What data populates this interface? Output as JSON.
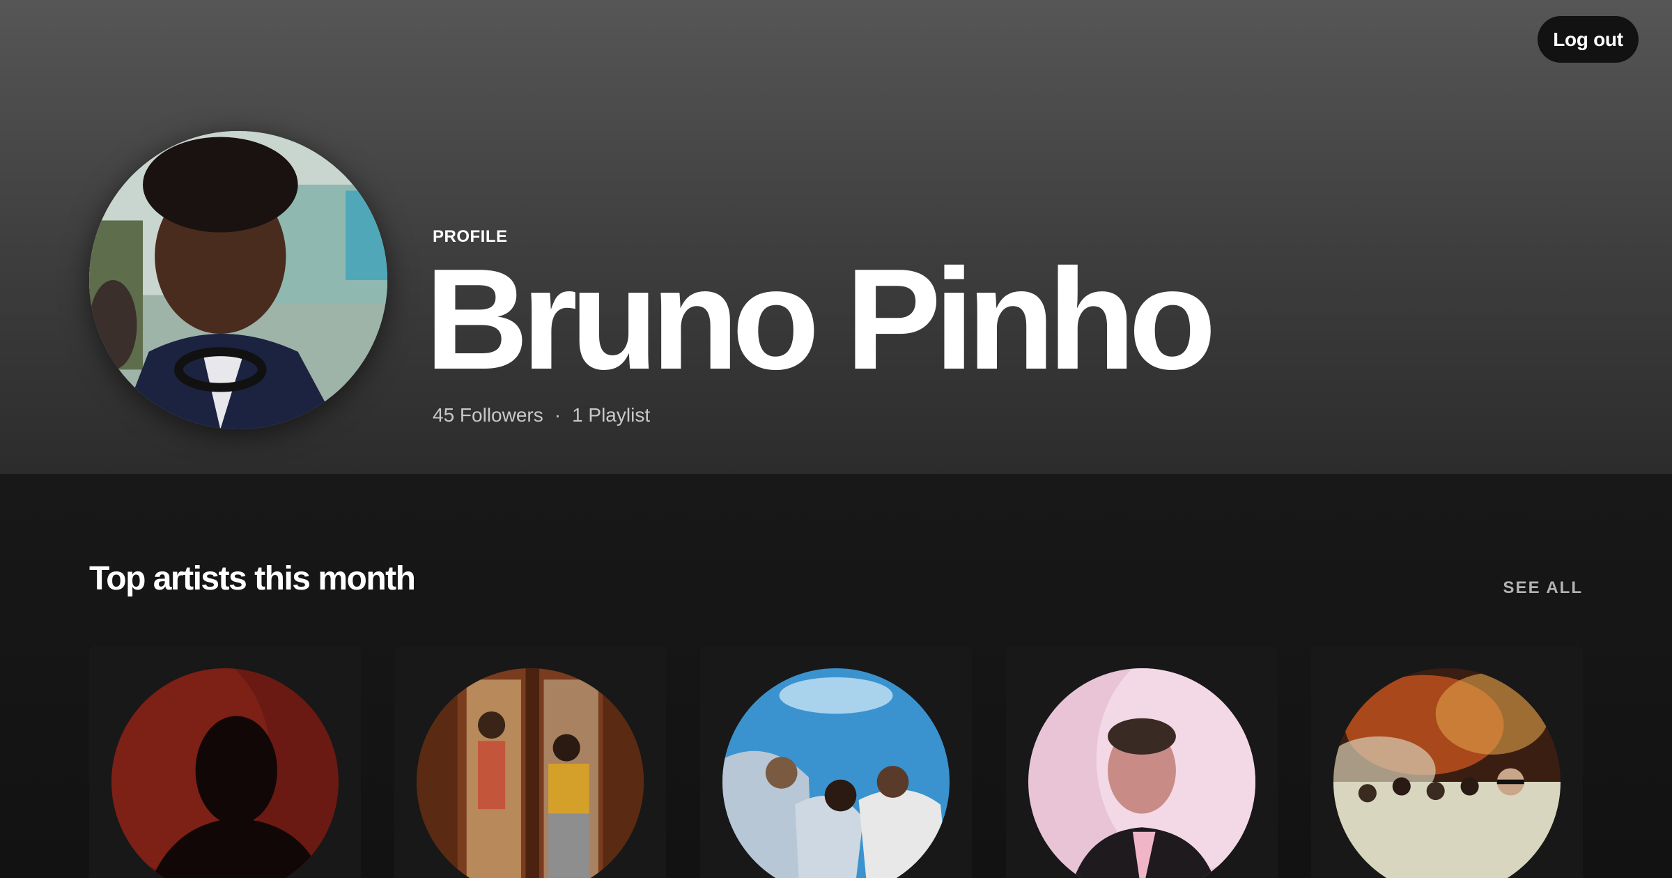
{
  "header": {
    "logout_label": "Log out",
    "profile_label": "PROFILE",
    "name": "Bruno Pinho",
    "followers": "45 Followers",
    "separator": "·",
    "playlists": "1 Playlist"
  },
  "section": {
    "title": "Top artists this month",
    "see_all_label": "SEE ALL"
  },
  "artists": [
    {
      "icon": "artist-silhouette-red"
    },
    {
      "icon": "artist-group-doorway"
    },
    {
      "icon": "artist-group-sky"
    },
    {
      "icon": "artist-portrait-pink"
    },
    {
      "icon": "artist-group-space"
    }
  ],
  "colors": {
    "background": "#121212",
    "card": "#181818",
    "header_top": "#565656",
    "muted_text": "#b3b3b3"
  }
}
